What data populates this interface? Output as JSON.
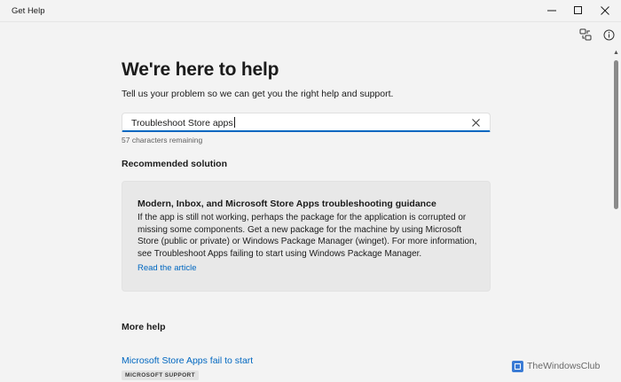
{
  "window": {
    "title": "Get Help"
  },
  "header": {
    "headline": "We're here to help",
    "subtext": "Tell us your problem so we can get you the right help and support."
  },
  "search": {
    "value": "Troubleshoot Store apps",
    "remaining": "57 characters remaining"
  },
  "recommended": {
    "section_title": "Recommended solution",
    "card_title": "Modern, Inbox, and Microsoft Store Apps troubleshooting guidance",
    "card_body": "If the app is still not working, perhaps the package for the application is corrupted or missing some components. Get a new package for the machine by using Microsoft Store (public or private) or Windows Package Manager (winget). For more information, see Troubleshoot Apps failing to start using Windows Package Manager.",
    "link": "Read the article"
  },
  "more_help": {
    "title": "More help",
    "items": [
      {
        "label": "Microsoft Store Apps fail to start",
        "badge": "MICROSOFT SUPPORT"
      }
    ]
  },
  "watermark": {
    "text": "TheWindowsClub"
  },
  "colors": {
    "accent": "#0067c0",
    "background": "#f3f3f3",
    "card": "#e8e8e8"
  },
  "icons": {
    "share": "share-connect-icon",
    "info": "info-icon",
    "clear": "close-icon"
  }
}
